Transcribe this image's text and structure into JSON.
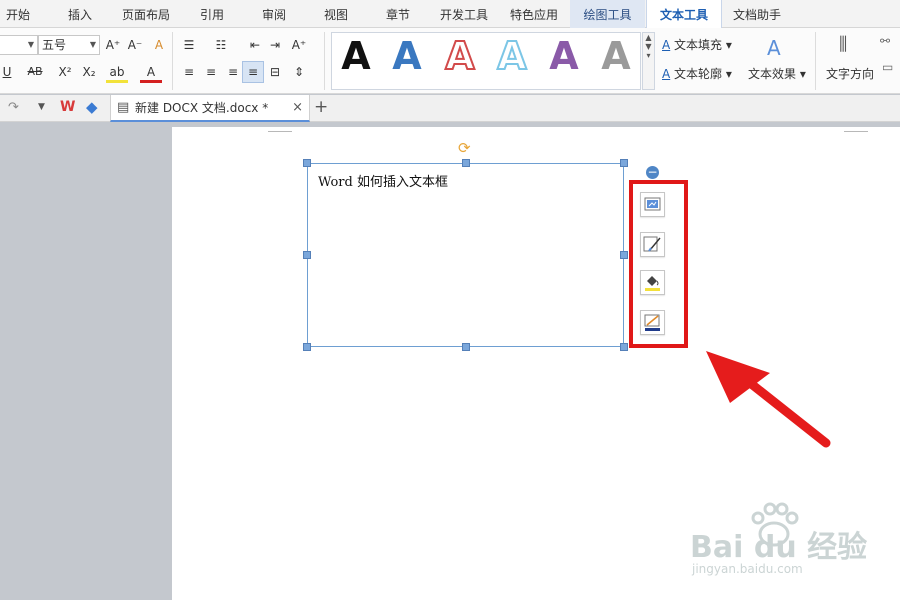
{
  "menu": {
    "tabs": [
      "开始",
      "插入",
      "页面布局",
      "引用",
      "审阅",
      "视图",
      "章节",
      "开发工具",
      "特色应用",
      "绘图工具",
      "文本工具",
      "文档助手"
    ],
    "active": "文本工具",
    "context": "绘图工具"
  },
  "ribbon": {
    "font_size": "五号",
    "grow_font": "A⁺",
    "shrink_font": "A⁻",
    "clear_format": "A",
    "underline": "U",
    "strike": "AB",
    "superscript": "X²",
    "subscript": "X₂",
    "highlight": "ab",
    "font_color": "A",
    "wordart_letter": "A",
    "wordart_colors": [
      "#111111",
      "#3a78c0",
      "#d24b4b",
      "#7cc6e6",
      "#8a5aa8",
      "#9a9a9a"
    ],
    "text_fill": "文本填充",
    "text_outline": "文本轮廓",
    "text_effect": "文本效果",
    "text_direction": "文字方向"
  },
  "tabbar": {
    "doc_name": "新建 DOCX 文档.docx *",
    "close": "×",
    "add": "+"
  },
  "textbox": {
    "content": "Word 如何插入文本框"
  },
  "sidebar": {
    "minus": "−",
    "buttons": [
      "layout-options",
      "shape-style",
      "fill-color",
      "outline-color"
    ]
  },
  "watermark": {
    "brand": "Bai du 经验",
    "url": "jingyan.baidu.com"
  },
  "colors": {
    "highlight_border": "#e01818",
    "arrow": "#e51c1c",
    "selection": "#6e9fd2",
    "active_tab": "#1e5fb3"
  }
}
